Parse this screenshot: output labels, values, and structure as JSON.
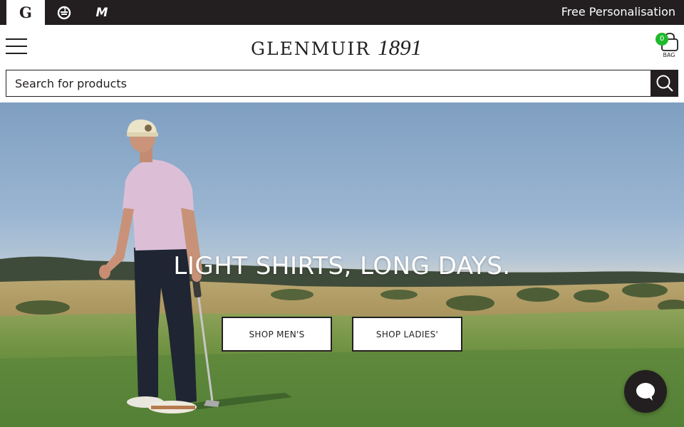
{
  "topbar": {
    "brands": [
      {
        "label": "G",
        "icon": "glenmuir-g-icon",
        "active": true
      },
      {
        "label": "",
        "icon": "swirl-logo-icon",
        "active": false
      },
      {
        "label": "M",
        "icon": "m-brand-icon",
        "active": false
      }
    ],
    "promo": "Free Personalisation"
  },
  "header": {
    "logo_word": "Glenmuir",
    "logo_year": "1891",
    "bag_count": "0",
    "bag_label": "BAG"
  },
  "search": {
    "placeholder": "Search for products",
    "value": ""
  },
  "hero": {
    "headline": "LIGHT SHIRTS, LONG DAYS.",
    "cta_men": "SHOP MEN'S",
    "cta_ladies": "SHOP LADIES'"
  },
  "colors": {
    "dark": "#231f20",
    "bag_badge": "#1fb92b",
    "sky": "#8faccb",
    "grass": "#5f8a3e"
  }
}
